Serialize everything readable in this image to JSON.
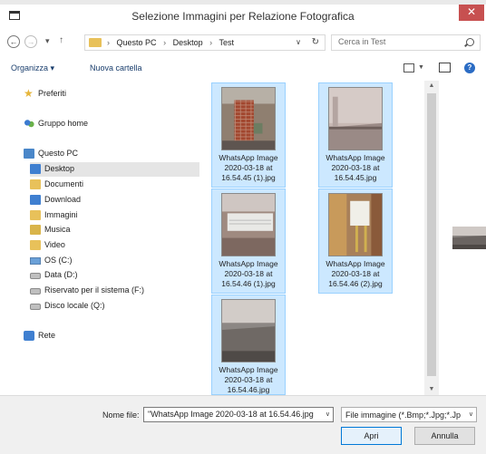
{
  "window": {
    "title": "Selezione Immagini per Relazione Fotografica",
    "close_glyph": "✕"
  },
  "address": {
    "crumbs": [
      "Questo PC",
      "Desktop",
      "Test"
    ],
    "search_placeholder": "Cerca in Test"
  },
  "toolbar": {
    "organize_label": "Organizza ▾",
    "new_folder_label": "Nuova cartella"
  },
  "sidebar": {
    "favorites": "Preferiti",
    "homegroup": "Gruppo home",
    "this_pc": "Questo PC",
    "items": [
      "Desktop",
      "Documenti",
      "Download",
      "Immagini",
      "Musica",
      "Video",
      "OS (C:)",
      "Data (D:)",
      "Riservato per il sistema (F:)",
      "Disco locale (Q:)"
    ],
    "network": "Rete"
  },
  "files": [
    {
      "line1": "WhatsApp Image",
      "line2": "2020-03-18 at",
      "line3": "16.54.45 (1).jpg"
    },
    {
      "line1": "WhatsApp Image",
      "line2": "2020-03-18 at",
      "line3": "16.54.45.jpg"
    },
    {
      "line1": "WhatsApp Image",
      "line2": "2020-03-18 at",
      "line3": "16.54.46 (1).jpg"
    },
    {
      "line1": "WhatsApp Image",
      "line2": "2020-03-18 at",
      "line3": "16.54.46 (2).jpg"
    },
    {
      "line1": "WhatsApp Image",
      "line2": "2020-03-18 at",
      "line3": "16.54.46.jpg"
    }
  ],
  "bottom": {
    "filename_label": "Nome file:",
    "filename_value": "\"WhatsApp Image 2020-03-18 at 16.54.46.jpg",
    "filetype_value": "File immagine (*.Bmp;*.Jpg;*.Jp",
    "open_label": "Apri",
    "cancel_label": "Annulla"
  },
  "colors": {
    "selection_fill": "#cce8ff",
    "selection_border": "#99d1ff",
    "close_red": "#c75050",
    "accent_blue": "#0078d7"
  }
}
